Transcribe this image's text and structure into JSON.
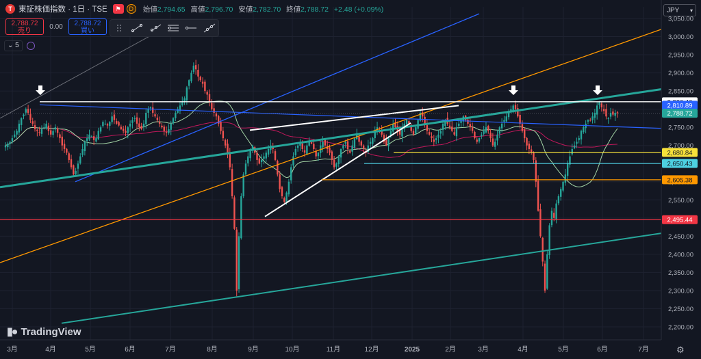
{
  "header": {
    "logo_letter": "T",
    "symbol": "東証株価指数 · 1日 · TSE",
    "flag_icon": "flag-icon",
    "d_badge": "D",
    "open_label": "始値",
    "open": "2,794.65",
    "high_label": "高値",
    "high": "2,796.70",
    "low_label": "安値",
    "low": "2,782.70",
    "close_label": "終値",
    "close": "2,788.72",
    "change": "+2.48 (+0.09%)"
  },
  "trade": {
    "sell_price": "2,788.72",
    "sell_label": "売り",
    "spread": "0.00",
    "buy_price": "2,788.72",
    "buy_label": "買い"
  },
  "toolbar_icons": [
    "drag-handle-icon",
    "trend-line-icon",
    "ray-icon",
    "horizontal-lines-icon",
    "horizontal-ray-icon",
    "extended-line-icon"
  ],
  "indicators": {
    "count": "5",
    "collapse_icon": "chevron-down-icon"
  },
  "currency": {
    "value": "JPY",
    "icon": "chevron-down-icon"
  },
  "watermark": "TradingView",
  "settings_icon": "gear-icon",
  "price_axis": {
    "ticks": [
      "3,050.00",
      "3,000.00",
      "2,950.00",
      "2,900.00",
      "2,850.00",
      "2,800.00",
      "2,750.00",
      "2,700.00",
      "2,650.00",
      "2,600.00",
      "2,550.00",
      "2,500.00",
      "2,450.00",
      "2,400.00",
      "2,350.00",
      "2,300.00",
      "2,250.00",
      "2,200.00"
    ],
    "tick_values": [
      3050,
      3000,
      2950,
      2900,
      2850,
      2800,
      2750,
      2700,
      2650,
      2600,
      2550,
      2500,
      2450,
      2400,
      2350,
      2300,
      2250,
      2200
    ]
  },
  "time_axis": {
    "labels": [
      "3月",
      "4月",
      "5月",
      "6月",
      "7月",
      "8月",
      "9月",
      "10月",
      "11月",
      "12月",
      "2025",
      "2月",
      "3月",
      "4月",
      "5月",
      "6月",
      "7月"
    ]
  },
  "price_labels": [
    {
      "text": "2,820.40",
      "value": 2820.4,
      "bg": "#ffffff",
      "fg": "#131722"
    },
    {
      "text": "2,810.89",
      "value": 2810.89,
      "bg": "#2962ff",
      "fg": "#ffffff"
    },
    {
      "text": "2,788.72",
      "value": 2788.72,
      "bg": "#26a69a",
      "fg": "#ffffff"
    },
    {
      "text": "2,680.84",
      "value": 2680.84,
      "bg": "#f7e13a",
      "fg": "#131722"
    },
    {
      "text": "2,650.43",
      "value": 2650.43,
      "bg": "#4dd0e1",
      "fg": "#131722"
    },
    {
      "text": "2,605.38",
      "value": 2605.38,
      "bg": "#ff9800",
      "fg": "#131722"
    },
    {
      "text": "2,495.44",
      "value": 2495.44,
      "bg": "#f23645",
      "fg": "#ffffff"
    }
  ],
  "colors": {
    "bg": "#131722",
    "grid": "#1e2230",
    "up": "#26a69a",
    "down": "#ef5350",
    "white_level": "#ffffff",
    "blue_level": "#2962ff",
    "yellow_level": "#f7e13a",
    "cyan_level": "#4dd0e1",
    "orange_level": "#ff9800",
    "red_level": "#f23645",
    "teal_trend": "#26a69a",
    "orange_trend": "#ff9800",
    "blue_trend": "#2962ff",
    "ma_short": "#a5d6a7",
    "ma_long": "#c2185b"
  },
  "chart_data": {
    "type": "candlestick",
    "ylim": [
      2170,
      3070
    ],
    "x_months": [
      "3月",
      "4月",
      "5月",
      "6月",
      "7月",
      "8月",
      "9月",
      "10月",
      "11月",
      "12月",
      "2025",
      "2月",
      "3月",
      "4月",
      "5月",
      "6月",
      "7月"
    ],
    "closes": [
      2700,
      2705,
      2710,
      2720,
      2730,
      2740,
      2760,
      2775,
      2785,
      2800,
      2790,
      2770,
      2760,
      2745,
      2740,
      2735,
      2745,
      2750,
      2760,
      2740,
      2730,
      2740,
      2750,
      2735,
      2720,
      2700,
      2690,
      2680,
      2660,
      2640,
      2620,
      2630,
      2650,
      2670,
      2690,
      2710,
      2720,
      2730,
      2725,
      2715,
      2720,
      2740,
      2750,
      2765,
      2760,
      2755,
      2765,
      2780,
      2770,
      2760,
      2755,
      2745,
      2740,
      2735,
      2750,
      2760,
      2770,
      2775,
      2760,
      2750,
      2745,
      2760,
      2790,
      2800,
      2805,
      2790,
      2780,
      2770,
      2760,
      2750,
      2740,
      2735,
      2745,
      2760,
      2775,
      2790,
      2800,
      2810,
      2820,
      2830,
      2860,
      2880,
      2900,
      2920,
      2910,
      2890,
      2880,
      2870,
      2850,
      2840,
      2820,
      2800,
      2790,
      2780,
      2760,
      2740,
      2720,
      2700,
      2680,
      2640,
      2560,
      2470,
      2300,
      2450,
      2560,
      2620,
      2650,
      2670,
      2690,
      2700,
      2680,
      2660,
      2650,
      2660,
      2670,
      2680,
      2690,
      2700,
      2690,
      2660,
      2620,
      2580,
      2560,
      2545,
      2570,
      2600,
      2640,
      2670,
      2690,
      2700,
      2710,
      2690,
      2680,
      2700,
      2710,
      2705,
      2690,
      2670,
      2680,
      2700,
      2710,
      2700,
      2690,
      2680,
      2660,
      2640,
      2650,
      2670,
      2690,
      2700,
      2710,
      2690,
      2680,
      2700,
      2720,
      2730,
      2710,
      2700,
      2690,
      2680,
      2700,
      2710,
      2720,
      2740,
      2750,
      2745,
      2730,
      2710,
      2700,
      2720,
      2740,
      2760,
      2750,
      2740,
      2730,
      2750,
      2760,
      2770,
      2760,
      2740,
      2730,
      2750,
      2770,
      2790,
      2780,
      2760,
      2740,
      2730,
      2720,
      2710,
      2720,
      2730,
      2740,
      2760,
      2770,
      2760,
      2750,
      2740,
      2730,
      2750,
      2760,
      2770,
      2780,
      2770,
      2760,
      2750,
      2740,
      2720,
      2710,
      2720,
      2730,
      2740,
      2750,
      2740,
      2720,
      2700,
      2710,
      2730,
      2750,
      2760,
      2770,
      2780,
      2790,
      2800,
      2810,
      2800,
      2780,
      2760,
      2740,
      2720,
      2700,
      2690,
      2680,
      2660,
      2600,
      2520,
      2450,
      2380,
      2300,
      2400,
      2480,
      2520,
      2500,
      2540,
      2560,
      2580,
      2600,
      2620,
      2650,
      2670,
      2690,
      2700,
      2710,
      2720,
      2740,
      2750,
      2760,
      2770,
      2770,
      2780,
      2790,
      2810,
      2820,
      2805,
      2795,
      2780,
      2775,
      2790,
      2785,
      2790,
      2789
    ]
  }
}
